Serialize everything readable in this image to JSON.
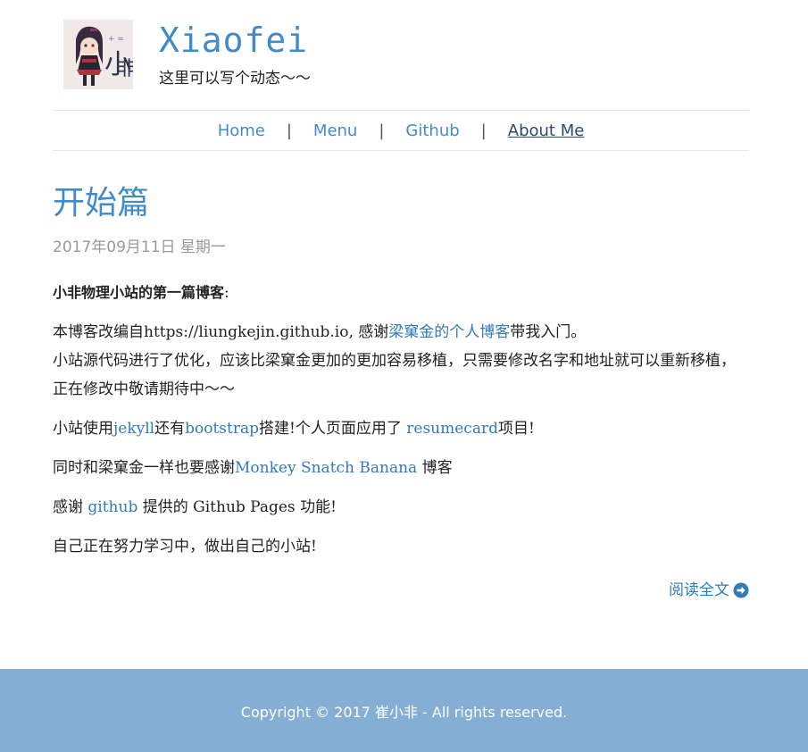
{
  "header": {
    "title": "Xiaofei",
    "tagline": "这里可以写个动态～～"
  },
  "nav": {
    "items": [
      {
        "label": "Home"
      },
      {
        "label": "Menu"
      },
      {
        "label": "Github"
      },
      {
        "label": "About Me"
      }
    ],
    "separator": "|"
  },
  "post": {
    "title": "开始篇",
    "date": "2017年09月11日 星期一",
    "p1_bold": "小非物理小站的第一篇博客",
    "p1_colon": ":",
    "p2_text1": "本博客改编自https://liungkejin.github.io, 感谢",
    "p2_link": "梁窠金的个人博客",
    "p2_text2": "带我入门。",
    "p2_text3": "小站源代码进行了优化，应该比梁窠金更加的更加容易移植，只需要修改名字和地址就可以重新移植，正在修改中敬请期待中～～",
    "p3_text1": "小站使用",
    "p3_link1": "jekyll",
    "p3_text2": "还有",
    "p3_link2": "bootstrap",
    "p3_text3": "搭建!个人页面应用了 ",
    "p3_link3": "resumecard",
    "p3_text4": "项目!",
    "p4_text1": "同时和梁窠金一样也要感谢",
    "p4_link": "Monkey Snatch Banana",
    "p4_text2": " 博客",
    "p5_text1": "感谢 ",
    "p5_link": "github",
    "p5_text2": " 提供的 Github Pages 功能!",
    "p6_text": "自己正在努力学习中，做出自己的小站!",
    "read_more": "阅读全文"
  },
  "footer": {
    "copyright": "Copyright © 2017 崔小非 - All rights reserved."
  },
  "colors": {
    "accent": "#428bca",
    "footer_bg": "#84aed3"
  },
  "icons": {
    "read_more": "circle-arrow-right-icon",
    "logo": "anime-girl-avatar"
  }
}
